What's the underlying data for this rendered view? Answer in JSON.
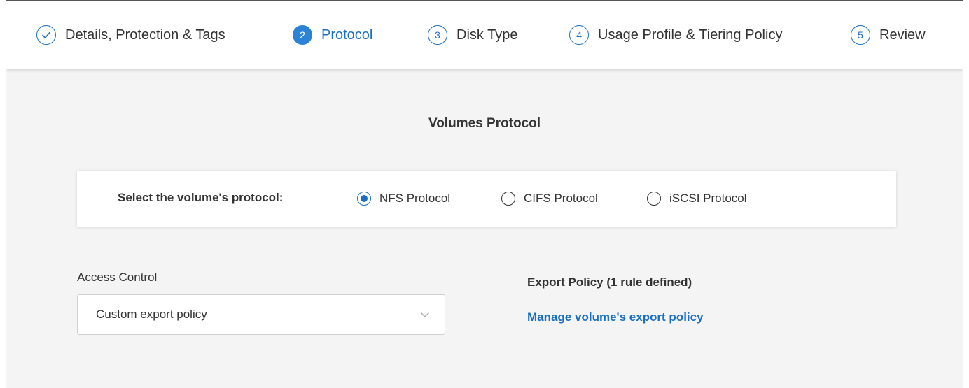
{
  "steps": [
    {
      "number": "",
      "label": "Details, Protection & Tags",
      "state": "completed"
    },
    {
      "number": "2",
      "label": "Protocol",
      "state": "active"
    },
    {
      "number": "3",
      "label": "Disk Type",
      "state": "pending"
    },
    {
      "number": "4",
      "label": "Usage Profile & Tiering Policy",
      "state": "pending"
    },
    {
      "number": "5",
      "label": "Review",
      "state": "pending"
    }
  ],
  "section_title": "Volumes Protocol",
  "protocol": {
    "prompt": "Select the volume's protocol:",
    "options": [
      {
        "label": "NFS Protocol",
        "selected": true
      },
      {
        "label": "CIFS Protocol",
        "selected": false
      },
      {
        "label": "iSCSI Protocol",
        "selected": false
      }
    ]
  },
  "access_control": {
    "label": "Access Control",
    "selected_value": "Custom export policy"
  },
  "export_policy": {
    "title": "Export Policy (1 rule defined)",
    "manage_link": "Manage volume's export policy"
  },
  "colors": {
    "accent": "#1a6fc2",
    "active_step_fill": "#2b82d6",
    "background": "#f4f4f4"
  }
}
